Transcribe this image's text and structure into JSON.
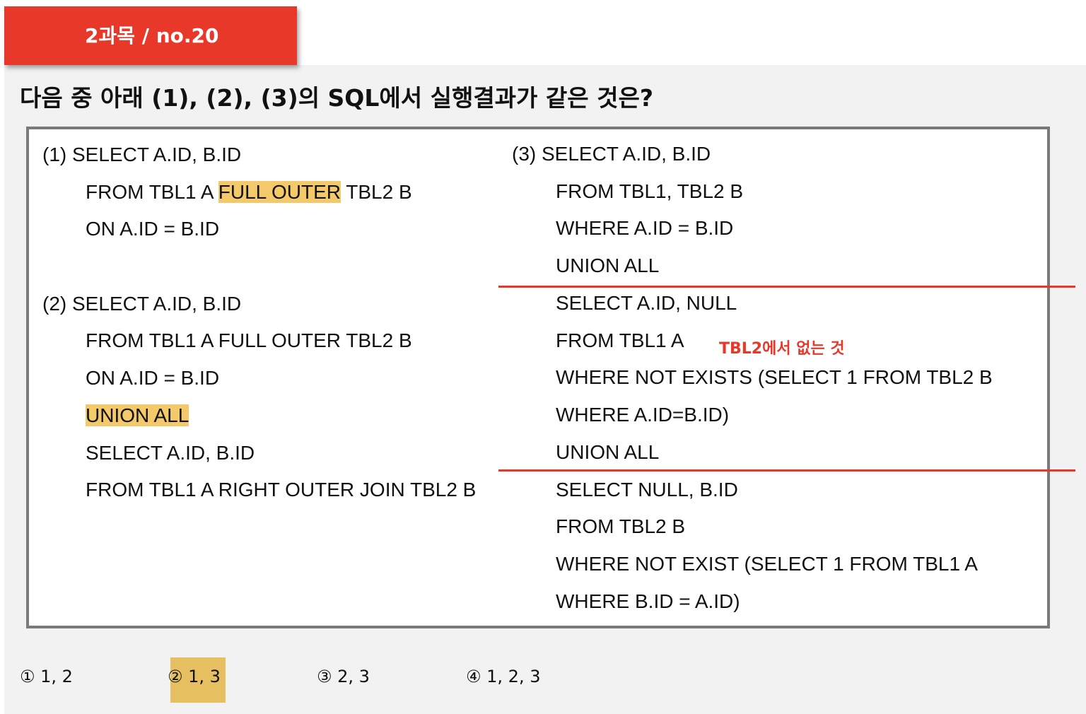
{
  "header": {
    "tag": "2과목 / no.20"
  },
  "question": {
    "text": "다음 중 아래 (1), (2), (3)의 SQL에서 실행결과가 같은 것은?"
  },
  "sql1": {
    "l1": "(1)  SELECT A.ID, B.ID",
    "l2_pre": "FROM TBL1 A ",
    "l2_hl": "FULL OUTER",
    "l2_post": " TBL2 B",
    "l3": "ON A.ID = B.ID"
  },
  "sql2": {
    "l1": "(2) SELECT A.ID, B.ID",
    "l2": "FROM TBL1 A FULL OUTER TBL2 B",
    "l3": "ON A.ID = B.ID",
    "l4_hl": "UNION ALL",
    "l5": "SELECT A.ID, B.ID",
    "l6": "FROM TBL1 A RIGHT OUTER JOIN TBL2 B"
  },
  "sql3": {
    "l1": "(3) SELECT A.ID, B.ID",
    "l2": "FROM TBL1, TBL2 B",
    "l3": "WHERE A.ID = B.ID",
    "l4": "UNION ALL",
    "l5": "SELECT A.ID, NULL",
    "l6": "FROM TBL1 A",
    "l7": "WHERE NOT EXISTS (SELECT 1 FROM TBL2 B",
    "l8": "WHERE A.ID=B.ID)",
    "l9": "UNION ALL",
    "l10": "SELECT NULL, B.ID",
    "l11": "FROM TBL2 B",
    "l12": "WHERE NOT EXIST (SELECT 1 FROM TBL1 A",
    "l13": "WHERE B.ID = A.ID)"
  },
  "annotation": {
    "text": "TBL2에서 없는 것"
  },
  "choices": [
    {
      "label": "① 1, 2"
    },
    {
      "label": "② 1, 3",
      "highlighted": true
    },
    {
      "label": "③ 2, 3"
    },
    {
      "label": "④ 1, 2, 3"
    }
  ],
  "colors": {
    "header_bg": "#e8382a",
    "highlight": "#f3c96a",
    "divider": "#e8382a",
    "annotation": "#e8382a",
    "box_border": "#7a7a7a"
  }
}
